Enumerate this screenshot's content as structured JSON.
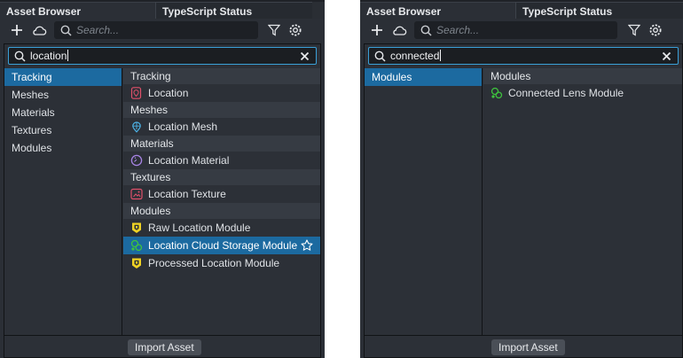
{
  "colors": {
    "panel_bg": "#2b2f36",
    "selection": "#1c6aa0",
    "focus_border": "#3aa0d8",
    "module_green": "#3ec33e",
    "module_yellow": "#f0d224",
    "material_purple": "#a884e6",
    "texture_red": "#e0506a",
    "tracking_red": "#e0506a",
    "mesh_blue": "#4db4e8"
  },
  "left": {
    "tabs": {
      "asset_browser": "Asset Browser",
      "typescript_status": "TypeScript Status"
    },
    "toolbar": {
      "search_placeholder": "Search..."
    },
    "filter": {
      "value": "location"
    },
    "categories": [
      "Tracking",
      "Meshes",
      "Materials",
      "Textures",
      "Modules"
    ],
    "groups": [
      {
        "header": "Tracking",
        "items": [
          {
            "label": "Location",
            "icon": "tracking-icon"
          }
        ]
      },
      {
        "header": "Meshes",
        "items": [
          {
            "label": "Location Mesh",
            "icon": "mesh-icon"
          }
        ]
      },
      {
        "header": "Materials",
        "items": [
          {
            "label": "Location Material",
            "icon": "material-icon"
          }
        ]
      },
      {
        "header": "Textures",
        "items": [
          {
            "label": "Location Texture",
            "icon": "texture-icon"
          }
        ]
      },
      {
        "header": "Modules",
        "items": [
          {
            "label": "Raw Location Module",
            "icon": "module-yellow-icon"
          },
          {
            "label": "Location Cloud Storage Module",
            "icon": "module-green-icon",
            "selected": true
          },
          {
            "label": "Processed Location Module",
            "icon": "module-yellow-icon"
          }
        ]
      }
    ],
    "footer": {
      "import_label": "Import Asset"
    }
  },
  "right": {
    "tabs": {
      "asset_browser": "Asset Browser",
      "typescript_status": "TypeScript Status"
    },
    "toolbar": {
      "search_placeholder": "Search..."
    },
    "filter": {
      "value": "connected"
    },
    "categories": [
      "Modules"
    ],
    "groups": [
      {
        "header": "Modules",
        "items": [
          {
            "label": "Connected Lens Module",
            "icon": "module-green-icon"
          }
        ]
      }
    ],
    "footer": {
      "import_label": "Import Asset"
    }
  }
}
